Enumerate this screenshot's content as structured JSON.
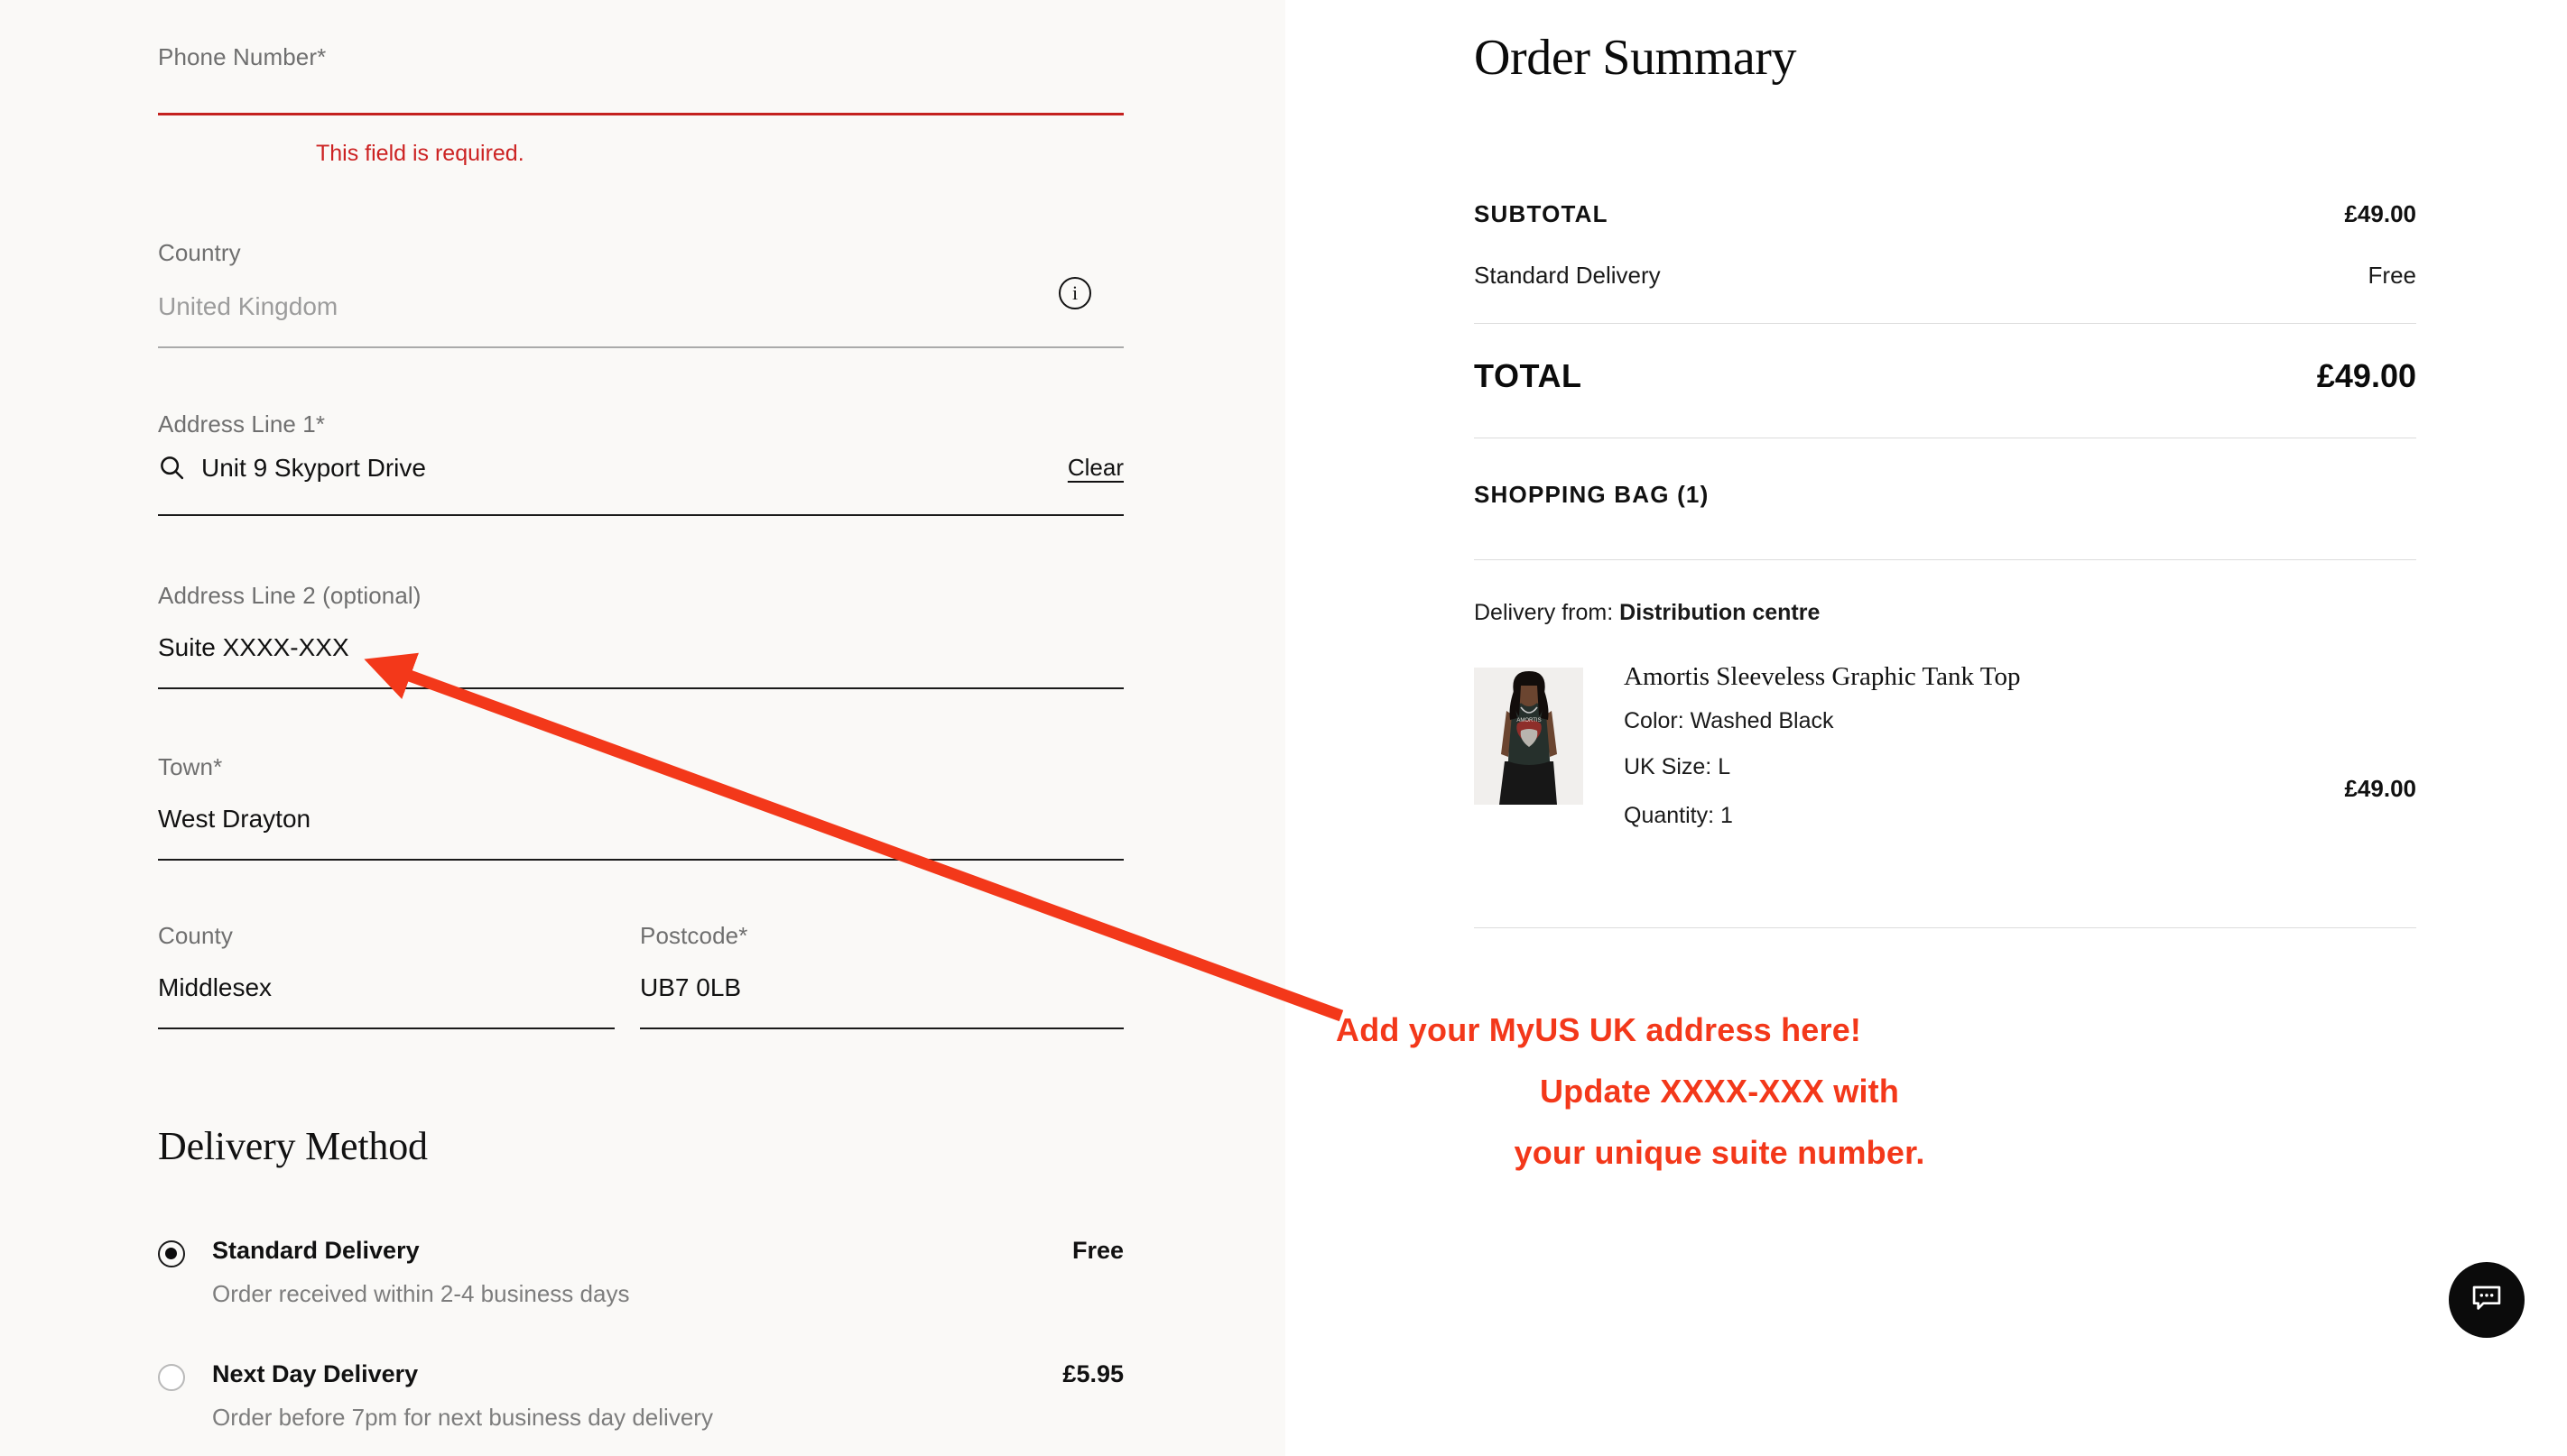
{
  "form": {
    "fields": [
      {
        "key": "phone",
        "label": "Phone Number*",
        "value": "",
        "error": "This field is required."
      },
      {
        "key": "country",
        "label": "Country",
        "value": "United Kingdom",
        "info_icon": "info-icon"
      },
      {
        "key": "address1",
        "label": "Address Line 1*",
        "value": "Unit 9 Skyport Drive",
        "search_icon": "search-icon",
        "clear_label": "Clear"
      },
      {
        "key": "address2",
        "label": "Address Line 2 (optional)",
        "value": "Suite XXXX-XXX"
      },
      {
        "key": "town",
        "label": "Town*",
        "value": "West Drayton"
      },
      {
        "key": "county",
        "label": "County",
        "value": "Middlesex"
      },
      {
        "key": "postcode",
        "label": "Postcode*",
        "value": "UB7 0LB"
      }
    ]
  },
  "delivery": {
    "title": "Delivery Method",
    "options": [
      {
        "label": "Standard Delivery",
        "price": "Free",
        "description": "Order received within 2-4 business days",
        "selected": true
      },
      {
        "label": "Next Day Delivery",
        "price": "£5.95",
        "description": "Order before 7pm for next business day delivery",
        "selected": false
      }
    ]
  },
  "order_summary": {
    "title": "Order Summary",
    "subtotal_label": "SUBTOTAL",
    "subtotal_value": "£49.00",
    "shipping_label": "Standard Delivery",
    "shipping_value": "Free",
    "total_label": "TOTAL",
    "total_value": "£49.00",
    "bag_label": "SHOPPING BAG (1)",
    "delivery_from_prefix": "Delivery from:",
    "delivery_from_value": "Distribution centre",
    "item": {
      "name": "Amortis Sleeveless Graphic Tank Top",
      "color": "Color: Washed Black",
      "size": "UK Size: L",
      "quantity": "Quantity: 1",
      "price": "£49.00"
    }
  },
  "annotation": {
    "line1": "Add your MyUS UK address here!",
    "line2": "Update XXXX-XXX with",
    "line3": "your unique suite number.",
    "color": "#f3381a"
  },
  "chat": {
    "icon": "chat-bubble-icon"
  },
  "colors": {
    "left_bg": "#faf9f7",
    "right_bg": "#ffffff",
    "error_red": "#cc2222",
    "annotation_red": "#f3381a",
    "text": "#111111",
    "muted": "#6f6f6f"
  }
}
